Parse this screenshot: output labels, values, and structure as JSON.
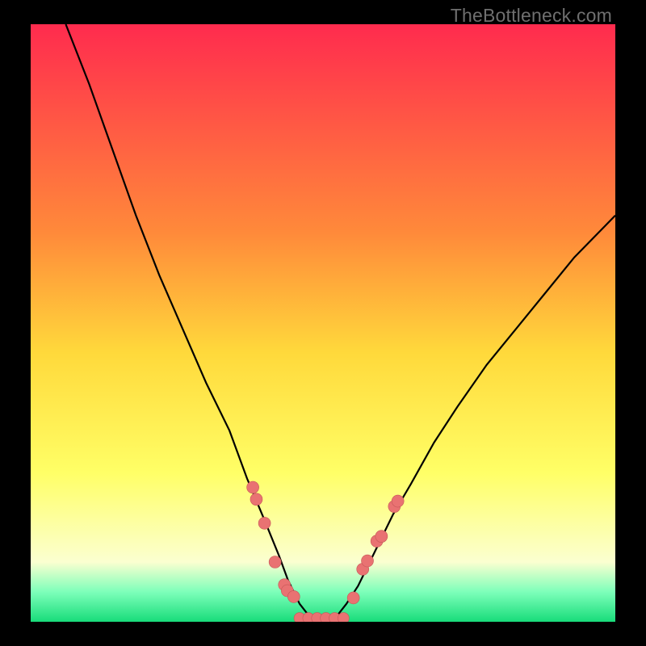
{
  "watermark": {
    "text": "TheBottleneck.com"
  },
  "colors": {
    "frame": "#000000",
    "curve": "#000000",
    "dot_fill": "#e97272",
    "dot_stroke": "#c55757",
    "grad_top": "#ff2b4e",
    "grad_mid_upper": "#ff8a3a",
    "grad_mid": "#ffd93b",
    "grad_mid_lower": "#ffff66",
    "grad_lower_pale": "#fbffd0",
    "grad_green_pale": "#7dffba",
    "grad_green": "#18dc7a"
  },
  "chart_data": {
    "type": "line",
    "title": "",
    "xlabel": "",
    "ylabel": "",
    "xlim": [
      0,
      100
    ],
    "ylim": [
      0,
      100
    ],
    "series": [
      {
        "name": "bottleneck-curve",
        "x": [
          6,
          10,
          14,
          18,
          22,
          26,
          30,
          34,
          37,
          40,
          42.5,
          44,
          46,
          48,
          52,
          54,
          56,
          58,
          60,
          62,
          65,
          69,
          73,
          78,
          83,
          88,
          93,
          98,
          100
        ],
        "values": [
          100,
          90,
          79,
          68,
          58,
          49,
          40,
          32,
          24,
          17,
          11,
          7,
          3,
          0.5,
          0.5,
          3,
          6,
          10,
          14,
          18,
          23,
          30,
          36,
          43,
          49,
          55,
          61,
          66,
          68
        ]
      }
    ],
    "markers_left": {
      "name": "dots-left",
      "x": [
        38.0,
        38.6,
        40.0,
        41.8,
        43.4,
        43.9,
        45.0
      ],
      "values": [
        22.5,
        20.5,
        16.5,
        10.0,
        6.2,
        5.2,
        4.2
      ]
    },
    "markers_right": {
      "name": "dots-right",
      "x": [
        55.2,
        56.8,
        57.6,
        59.2,
        60.0,
        62.2,
        62.8
      ],
      "values": [
        4.0,
        8.8,
        10.2,
        13.5,
        14.3,
        19.3,
        20.2
      ]
    },
    "markers_bottom": {
      "name": "dots-bottom",
      "x": [
        46.0,
        47.5,
        49.0,
        50.5,
        52.0,
        53.5
      ],
      "values": [
        0.6,
        0.6,
        0.6,
        0.6,
        0.6,
        0.6
      ]
    }
  }
}
